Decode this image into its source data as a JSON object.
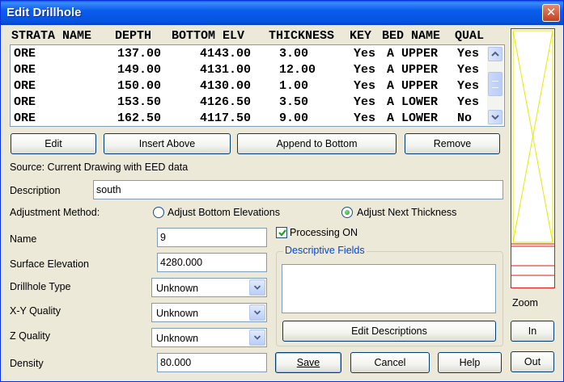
{
  "window": {
    "title": "Edit Drillhole",
    "close_glyph": "✕"
  },
  "table": {
    "headers": [
      "STRATA NAME",
      "DEPTH",
      "BOTTOM ELV",
      "THICKNESS",
      "KEY",
      "BED NAME",
      "QUAL"
    ],
    "rows": [
      [
        "ORE",
        "137.00",
        "4143.00",
        "3.00",
        "Yes",
        "A UPPER",
        "Yes"
      ],
      [
        "ORE",
        "149.00",
        "4131.00",
        "12.00",
        "Yes",
        "A UPPER",
        "Yes"
      ],
      [
        "ORE",
        "150.00",
        "4130.00",
        "1.00",
        "Yes",
        "A UPPER",
        "Yes"
      ],
      [
        "ORE",
        "153.50",
        "4126.50",
        "3.50",
        "Yes",
        "A LOWER",
        "Yes"
      ],
      [
        "ORE",
        "162.50",
        "4117.50",
        "9.00",
        "Yes",
        "A LOWER",
        "No"
      ]
    ]
  },
  "buttons": {
    "edit": "Edit",
    "insert_above": "Insert Above",
    "append": "Append to Bottom",
    "remove": "Remove",
    "edit_descriptions": "Edit Descriptions",
    "save": "Save",
    "cancel": "Cancel",
    "help": "Help",
    "zoom_in": "In",
    "zoom_out": "Out"
  },
  "source_text": "Source: Current Drawing with EED data",
  "description": {
    "label": "Description",
    "value": "south"
  },
  "adjustment": {
    "label": "Adjustment Method:",
    "option_bottom": "Adjust Bottom Elevations",
    "option_next": "Adjust Next Thickness",
    "selected": "next"
  },
  "processing": {
    "label": "Processing ON",
    "checked": true
  },
  "fields": {
    "name": {
      "label": "Name",
      "value": "9"
    },
    "surface_elevation": {
      "label": "Surface Elevation",
      "value": "4280.000"
    },
    "drillhole_type": {
      "label": "Drillhole Type",
      "value": "Unknown"
    },
    "xy_quality": {
      "label": "X-Y Quality",
      "value": "Unknown"
    },
    "z_quality": {
      "label": "Z Quality",
      "value": "Unknown"
    },
    "density": {
      "label": "Density",
      "value": "80.000"
    }
  },
  "descriptive_fields": {
    "title": "Descriptive Fields"
  },
  "zoom": {
    "label": "Zoom"
  },
  "colors": {
    "title_bar": "#0b5ded",
    "preview_yellow": "#e8e800",
    "preview_red": "#d11a1a",
    "group_title": "#0046d5"
  }
}
